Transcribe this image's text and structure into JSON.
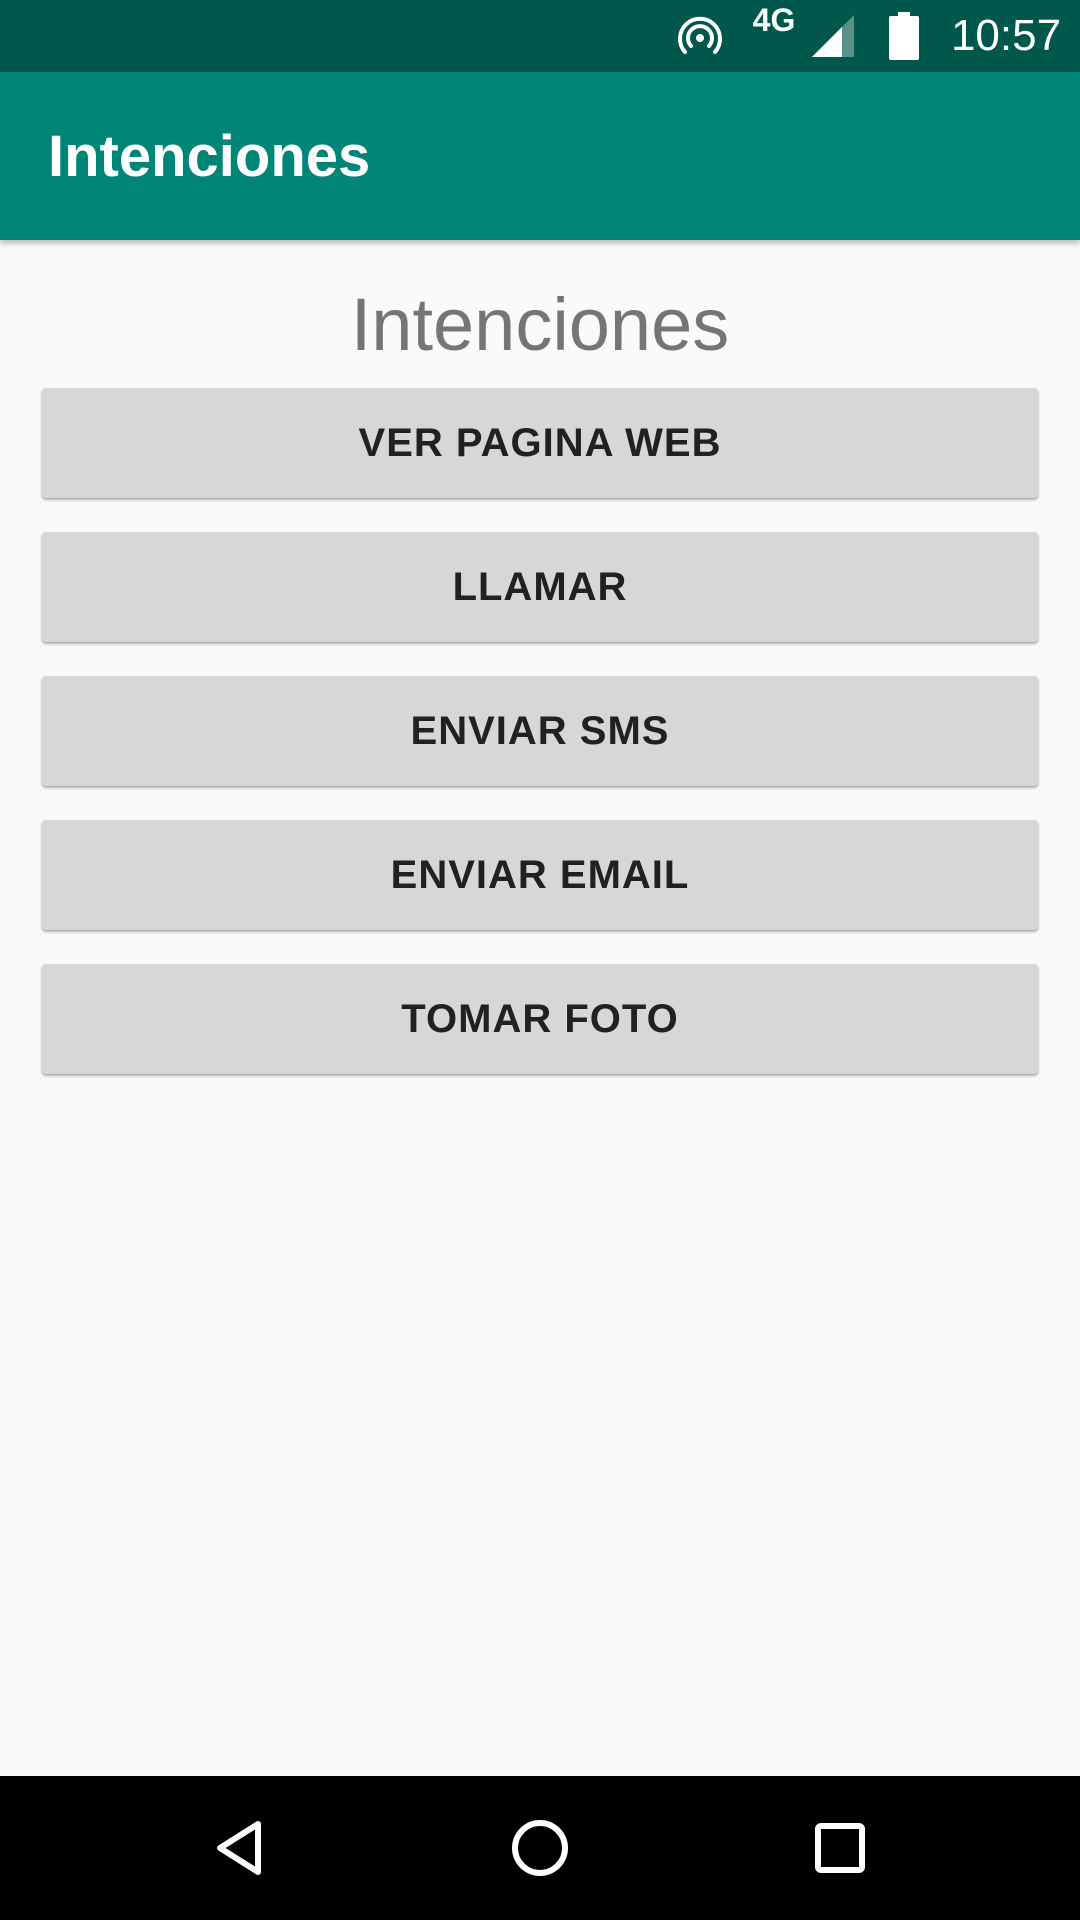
{
  "status_bar": {
    "network": "4G",
    "time": "10:57",
    "icons": [
      "hotspot-icon",
      "signal-icon",
      "battery-icon"
    ]
  },
  "app_bar": {
    "title": "Intenciones",
    "color": "#008577"
  },
  "main": {
    "heading": "Intenciones",
    "buttons": [
      {
        "label": "VER PAGINA WEB"
      },
      {
        "label": "LLAMAR"
      },
      {
        "label": "ENVIAR SMS"
      },
      {
        "label": "ENVIAR EMAIL"
      },
      {
        "label": "TOMAR FOTO"
      }
    ]
  },
  "nav_bar": {
    "icons": [
      "back-icon",
      "home-icon",
      "recents-icon"
    ]
  },
  "colors": {
    "status_bar": "#00574b",
    "primary": "#008577",
    "background": "#fafafa",
    "button": "#d6d7d7",
    "button_text": "#212121",
    "heading_text": "#757575"
  }
}
